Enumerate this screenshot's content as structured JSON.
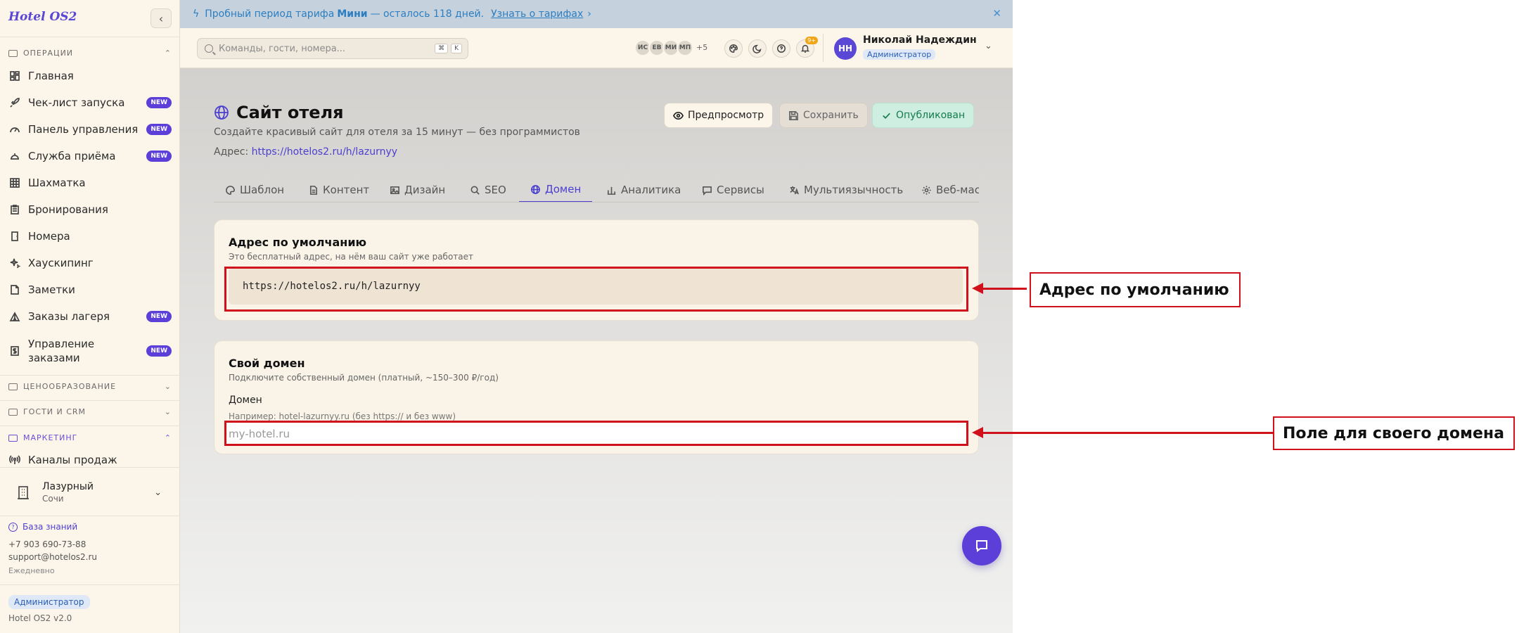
{
  "sidebar": {
    "brand": "Hotel OS2",
    "section_operations": "Операции",
    "items": [
      {
        "label": "Главная",
        "icon": "dashboard-icon",
        "new": false
      },
      {
        "label": "Чек-лист запуска",
        "icon": "rocket-icon",
        "new": true
      },
      {
        "label": "Панель управления",
        "icon": "gauge-icon",
        "new": true
      },
      {
        "label": "Служба приёма",
        "icon": "bell-service-icon",
        "new": true
      },
      {
        "label": "Шахматка",
        "icon": "grid-icon",
        "new": false
      },
      {
        "label": "Бронирования",
        "icon": "clipboard-icon",
        "new": false
      },
      {
        "label": "Номера",
        "icon": "door-icon",
        "new": false
      },
      {
        "label": "Хаускипинг",
        "icon": "sparkles-icon",
        "new": false
      },
      {
        "label": "Заметки",
        "icon": "note-icon",
        "new": false
      },
      {
        "label": "Заказы лагеря",
        "icon": "tent-icon",
        "new": true
      },
      {
        "label": "Управление заказами",
        "icon": "receipt-icon",
        "new": true
      }
    ],
    "new_badge": "NEW",
    "section_pricing": "Ценообразование",
    "section_guests": "Гости и CRM",
    "section_marketing": "Маркетинг",
    "marketing_item": "Каналы продаж",
    "hotel_name": "Лазурный",
    "hotel_city": "Сочи",
    "knowledge_base": "База знаний",
    "phone": "+7 903 690-73-88",
    "email": "support@hotelos2.ru",
    "schedule": "Ежедневно",
    "role": "Администратор",
    "version": "Hotel OS2 v2.0"
  },
  "trial_banner": {
    "prefix": "Пробный период тарифа",
    "plan": "Мини",
    "suffix": "— осталось 118 дней.",
    "link": "Узнать о тарифах",
    "link_arrow": "›",
    "close": "✕"
  },
  "topbar": {
    "search_placeholder": "Команды, гости, номера...",
    "search_key1": "⌘",
    "search_key2": "K",
    "avatars": [
      "ИС",
      "ЕВ",
      "МИ",
      "МП"
    ],
    "avatars_more": "+5",
    "notif_count": "9+",
    "user_initials": "НН",
    "user_name": "Николай Надеждин",
    "user_role": "Администратор"
  },
  "page": {
    "title": "Сайт отеля",
    "subtitle": "Создайте красивый сайт для отеля за 15 минут — без программистов",
    "address_label": "Адрес:",
    "address_url": "https://hotelos2.ru/h/lazurnyy",
    "btn_preview": "Предпросмотр",
    "btn_save": "Сохранить",
    "btn_published": "Опубликован",
    "tabs": [
      "Шаблон",
      "Контент",
      "Дизайн",
      "SEO",
      "Домен",
      "Аналитика",
      "Сервисы",
      "Мультиязычность",
      "Веб-мас"
    ]
  },
  "default_card": {
    "title": "Адрес по умолчанию",
    "subtitle": "Это бесплатный адрес, на нём ваш сайт уже работает",
    "url": "https://hotelos2.ru/h/lazurnyy"
  },
  "custom_card": {
    "title": "Свой домен",
    "subtitle": "Подключите собственный домен (платный, ~150–300 ₽/год)",
    "field_label": "Домен",
    "field_hint": "Например: hotel-lazurnyy.ru (без https:// и без www)",
    "field_placeholder": "my-hotel.ru"
  },
  "annotations": {
    "default_address": "Адрес по умолчанию",
    "custom_domain": "Поле для своего домена"
  }
}
